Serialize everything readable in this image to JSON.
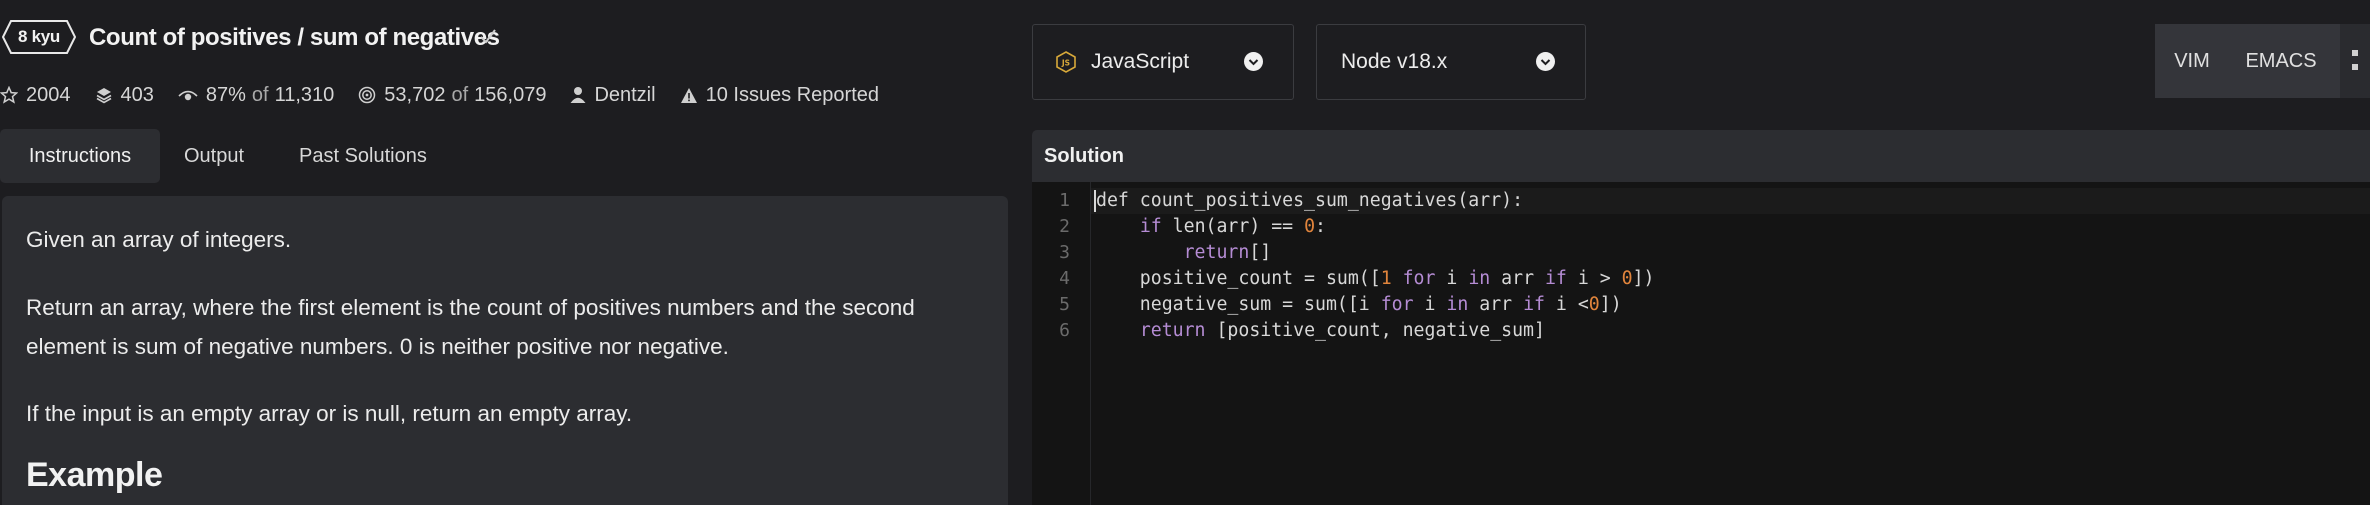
{
  "kata": {
    "rank": "8 kyu",
    "title": "Count of positives / sum of negatives"
  },
  "stats": {
    "stars": "2004",
    "collections": "403",
    "satisfaction": "87%",
    "satisfaction_of": "of",
    "satisfaction_votes": "11,310",
    "completed": "53,702",
    "completed_of": "of",
    "attempted": "156,079",
    "author": "Dentzil",
    "issues": "10 Issues Reported"
  },
  "tabs": [
    "Instructions",
    "Output",
    "Past Solutions"
  ],
  "instructions": {
    "p1": "Given an array of integers.",
    "p2": "Return an array, where the first element is the count of positives numbers and the second element is sum of negative numbers. 0 is neither positive nor negative.",
    "p3": "If the input is an empty array or is null, return an empty array.",
    "example_heading": "Example"
  },
  "selectors": {
    "language": "JavaScript",
    "runtime": "Node v18.x"
  },
  "keybindings": [
    "VIM",
    "EMACS"
  ],
  "solution": {
    "header": "Solution",
    "line_numbers": [
      "1",
      "2",
      "3",
      "4",
      "5",
      "6"
    ]
  },
  "colors": {
    "background": "#1d1d20",
    "panel": "#2c2d31",
    "editor": "#141414",
    "keyword": "#b58cd4",
    "number": "#e0843c"
  }
}
